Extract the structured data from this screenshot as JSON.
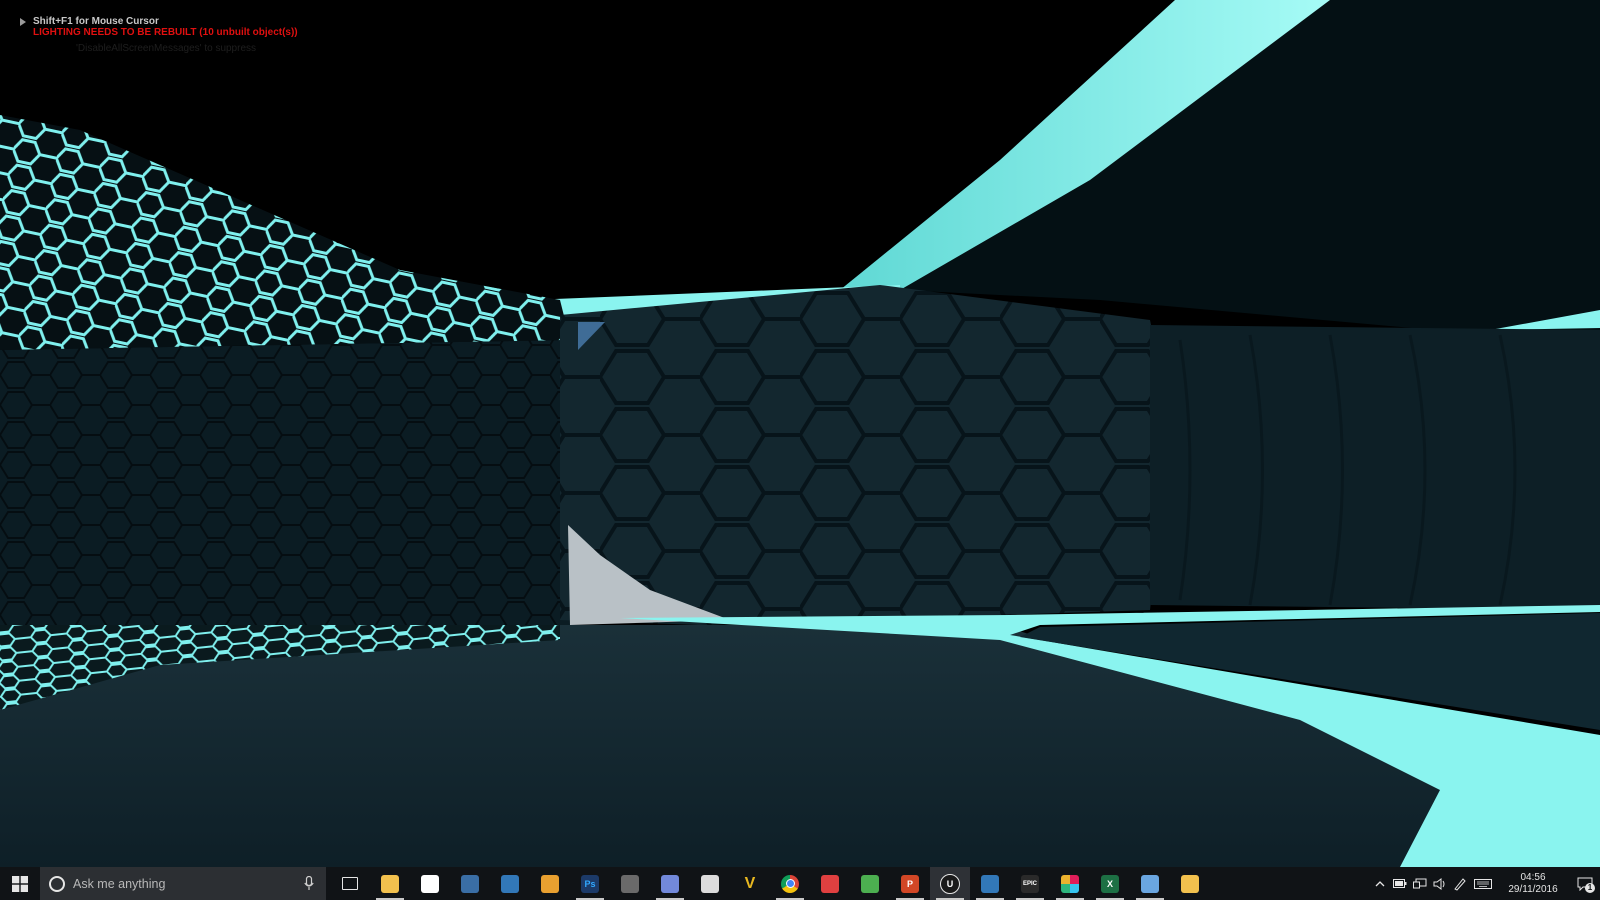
{
  "overlay": {
    "cursor_hint": "Shift+F1 for Mouse Cursor",
    "lighting_warning": "LIGHTING NEEDS TO BE REBUILT (10 unbuilt object(s))",
    "disable_hint": "'DisableAllScreenMessages' to suppress"
  },
  "taskbar": {
    "search_placeholder": "Ask me anything",
    "apps": [
      {
        "name": "Task View",
        "icon": "task-view-icon",
        "glyph": "",
        "color": "#101316",
        "open": false
      },
      {
        "name": "File Explorer",
        "icon": "file-explorer-icon",
        "glyph": "",
        "color": "#f2c14e",
        "open": true
      },
      {
        "name": "Store",
        "icon": "store-icon",
        "glyph": "",
        "color": "#ffffff",
        "open": false
      },
      {
        "name": "Steam",
        "icon": "steam-icon",
        "glyph": "",
        "color": "#3a6ea5",
        "open": false
      },
      {
        "name": "Visual Studio",
        "icon": "visual-studio-icon",
        "glyph": "",
        "color": "#3278b8",
        "open": false
      },
      {
        "name": "Lightning app",
        "icon": "lightning-icon",
        "glyph": "",
        "color": "#e8a030",
        "open": false
      },
      {
        "name": "Photoshop",
        "icon": "photoshop-icon",
        "glyph": "Ps",
        "color": "#1c3a68",
        "open": true
      },
      {
        "name": "Tool",
        "icon": "tool-icon",
        "glyph": "",
        "color": "#6a6a6a",
        "open": false
      },
      {
        "name": "Discord",
        "icon": "discord-icon",
        "glyph": "",
        "color": "#7289da",
        "open": true
      },
      {
        "name": "Figure app",
        "icon": "figure-icon",
        "glyph": "",
        "color": "#dcdcdc",
        "open": false
      },
      {
        "name": "Vectorize",
        "icon": "v-logo-icon",
        "glyph": "V",
        "color": "#e8b820",
        "open": false
      },
      {
        "name": "Chrome",
        "icon": "chrome-icon",
        "glyph": "",
        "color": "#db4437",
        "open": true
      },
      {
        "name": "Swirl app",
        "icon": "swirl-icon",
        "glyph": "",
        "color": "#e04040",
        "open": false
      },
      {
        "name": "Globe app",
        "icon": "globe-icon",
        "glyph": "",
        "color": "#4caf50",
        "open": false
      },
      {
        "name": "PowerPoint",
        "icon": "powerpoint-icon",
        "glyph": "P",
        "color": "#d24726",
        "open": true
      },
      {
        "name": "Unreal Engine",
        "icon": "unreal-engine-icon",
        "glyph": "U",
        "color": "#1a1a1a",
        "open": true,
        "active": true
      },
      {
        "name": "Visual Studio 2",
        "icon": "visual-studio-icon",
        "glyph": "",
        "color": "#3278b8",
        "open": true
      },
      {
        "name": "Epic Games",
        "icon": "epic-games-icon",
        "glyph": "EPIC",
        "color": "#2a2a2a",
        "open": true
      },
      {
        "name": "Slack",
        "icon": "slack-icon",
        "glyph": "",
        "color": "#e01e5a",
        "open": true
      },
      {
        "name": "Excel",
        "icon": "excel-icon",
        "glyph": "X",
        "color": "#1d7044",
        "open": true
      },
      {
        "name": "Paint app",
        "icon": "paint-icon",
        "glyph": "",
        "color": "#6aa6e0",
        "open": true
      },
      {
        "name": "Files",
        "icon": "folder-doc-icon",
        "glyph": "",
        "color": "#f2c14e",
        "open": false
      }
    ],
    "clock_time": "04:56",
    "clock_date": "29/11/2016",
    "notifications_count": "1"
  }
}
